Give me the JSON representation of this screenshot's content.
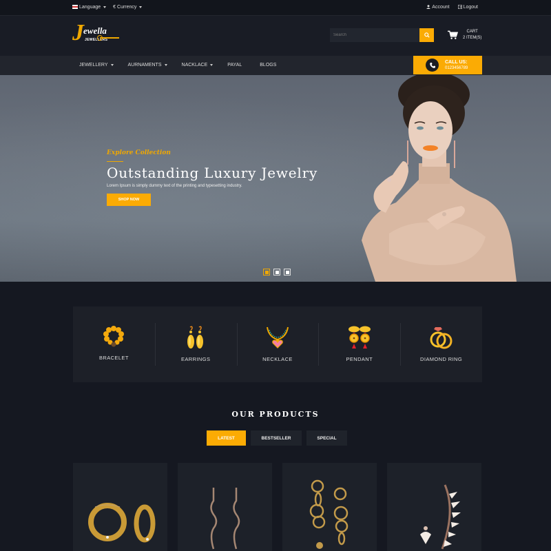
{
  "topbar": {
    "language": "Language",
    "currency_symbol": "€",
    "currency": "Currency",
    "account": "Account",
    "logout": "Logout"
  },
  "header": {
    "logo_initial": "J",
    "logo_name": "ewella",
    "logo_sub": "JEWELLERS",
    "search_placeholder": "Search",
    "cart_label": "CART",
    "cart_count": "2 ITEM(S)"
  },
  "nav": {
    "items": [
      {
        "label": "JEWELLERY",
        "dropdown": true
      },
      {
        "label": "AURNAMENTS",
        "dropdown": true
      },
      {
        "label": "NACKLACE",
        "dropdown": true
      },
      {
        "label": "PAYAL",
        "dropdown": false
      },
      {
        "label": "BLOGS",
        "dropdown": false
      }
    ],
    "call_label": "CALL US:",
    "call_number": "0123456789"
  },
  "hero": {
    "eyebrow": "Explore Collection",
    "title": "Outstanding Luxury Jewelry",
    "subtitle": "Lorem Ipsum is simply dummy text of the printing and typesetting industry.",
    "cta": "SHOP NOW",
    "slides": 3,
    "active_slide": 1
  },
  "categories": [
    {
      "label": "BRACELET",
      "icon": "bracelet-icon"
    },
    {
      "label": "EARRINGS",
      "icon": "earrings-icon"
    },
    {
      "label": "NECKLACE",
      "icon": "necklace-icon"
    },
    {
      "label": "PENDANT",
      "icon": "pendant-icon"
    },
    {
      "label": "DIAMOND RING",
      "icon": "diamond-ring-icon"
    }
  ],
  "products": {
    "title": "OUR PRODUCTS",
    "tabs": [
      {
        "label": "LATEST",
        "active": true
      },
      {
        "label": "BESTSELLER",
        "active": false
      },
      {
        "label": "SPECIAL",
        "active": false
      }
    ],
    "items": [
      {
        "name": "gold-hoop-earrings"
      },
      {
        "name": "wave-drop-earrings"
      },
      {
        "name": "chain-link-earrings"
      },
      {
        "name": "ear-cuff-set"
      }
    ]
  },
  "colors": {
    "accent": "#fbab04",
    "background": "#151821",
    "panel": "#1d2028"
  }
}
